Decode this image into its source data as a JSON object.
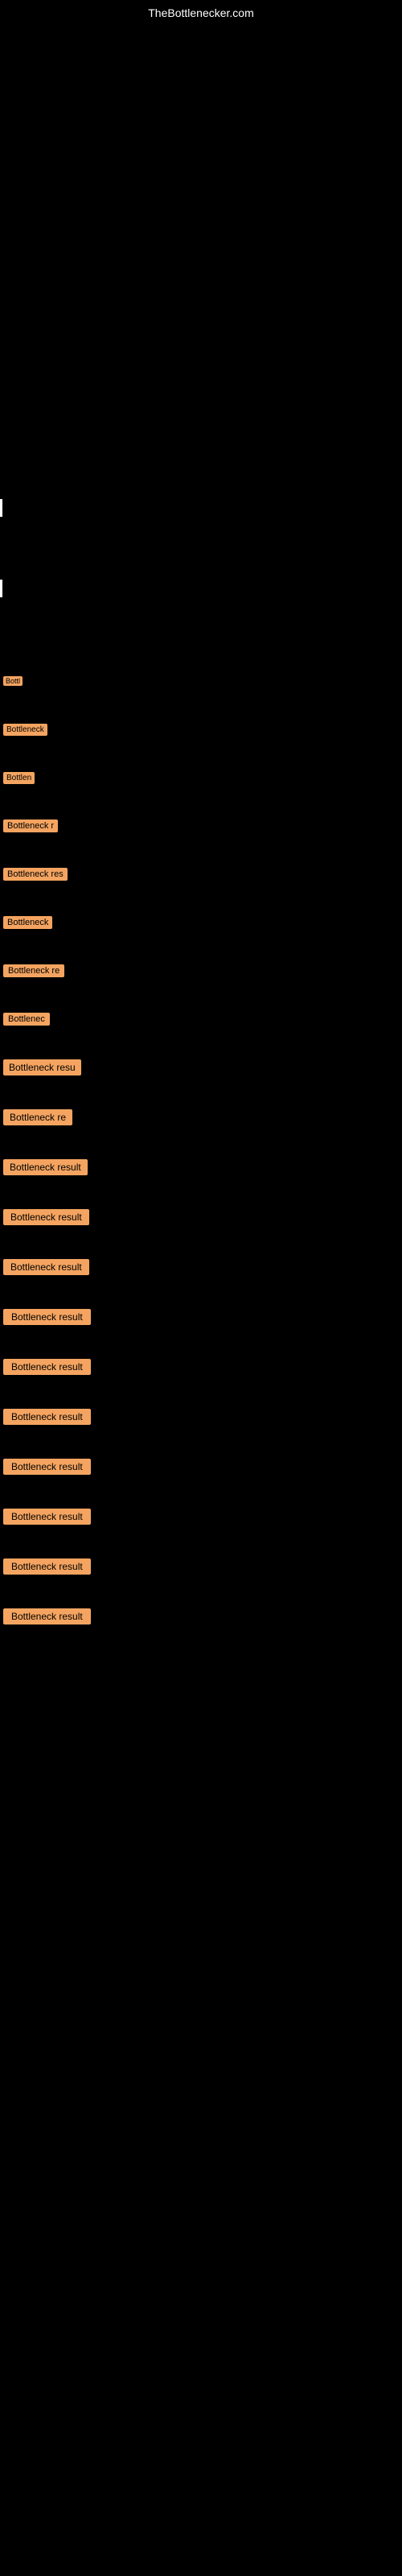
{
  "site": {
    "title": "TheBottlenecker.com"
  },
  "bottleneck_items": [
    {
      "id": 1,
      "label": "Bottl"
    },
    {
      "id": 2,
      "label": "Bottleneck"
    },
    {
      "id": 3,
      "label": "Bottlen"
    },
    {
      "id": 4,
      "label": "Bottleneck r"
    },
    {
      "id": 5,
      "label": "Bottleneck res"
    },
    {
      "id": 6,
      "label": "Bottleneck"
    },
    {
      "id": 7,
      "label": "Bottleneck re"
    },
    {
      "id": 8,
      "label": "Bottlenec"
    },
    {
      "id": 9,
      "label": "Bottleneck resu"
    },
    {
      "id": 10,
      "label": "Bottleneck re"
    },
    {
      "id": 11,
      "label": "Bottleneck result"
    },
    {
      "id": 12,
      "label": "Bottleneck result"
    },
    {
      "id": 13,
      "label": "Bottleneck result"
    },
    {
      "id": 14,
      "label": "Bottleneck result"
    },
    {
      "id": 15,
      "label": "Bottleneck result"
    },
    {
      "id": 16,
      "label": "Bottleneck result"
    },
    {
      "id": 17,
      "label": "Bottleneck result"
    },
    {
      "id": 18,
      "label": "Bottleneck result"
    },
    {
      "id": 19,
      "label": "Bottleneck result"
    },
    {
      "id": 20,
      "label": "Bottleneck result"
    }
  ]
}
